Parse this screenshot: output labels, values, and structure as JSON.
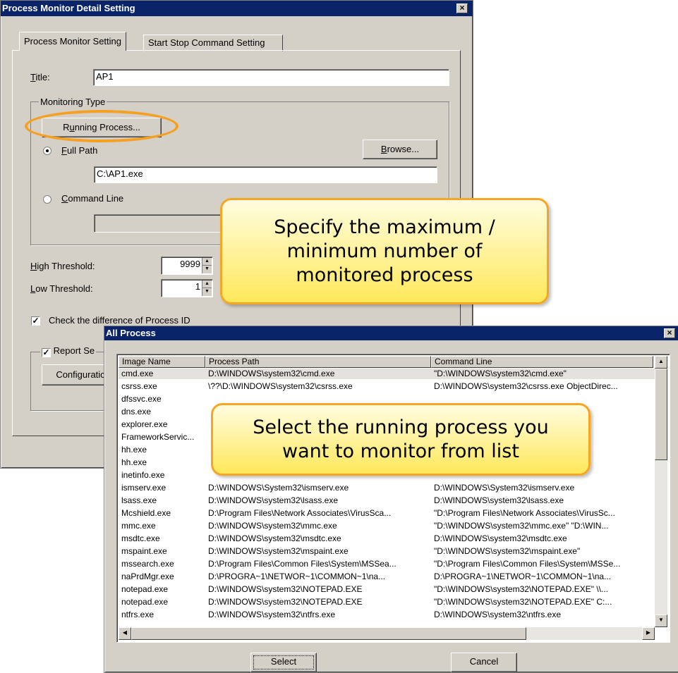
{
  "dialog1": {
    "title": "Process Monitor Detail Setting",
    "close_glyph": "×",
    "tabs": [
      "Process Monitor Setting",
      "Start Stop Command Setting"
    ],
    "title_label": "Title:",
    "title_value": "AP1",
    "monitoring_type_legend": "Monitoring Type",
    "running_process_button": "Running Process...",
    "full_path_label": "Full Path",
    "browse_button": "Browse...",
    "full_path_value": "C:\\AP1.exe",
    "command_line_label": "Command Line",
    "command_line_value": "",
    "high_threshold_label": "High Threshold:",
    "high_threshold_value": "9999",
    "low_threshold_label": "Low Threshold:",
    "low_threshold_value": "1",
    "check_pid_label": "Check the difference of Process ID",
    "check_pid_checked": true,
    "report_label": "Report Se",
    "report_checked": true,
    "configuration_button": "Configuratic"
  },
  "dialog2": {
    "title": "All Process",
    "close_glyph": "×",
    "columns": [
      "Image Name",
      "Process Path",
      "Command Line"
    ],
    "rows": [
      [
        "cmd.exe",
        "D:\\WINDOWS\\system32\\cmd.exe",
        "\"D:\\WINDOWS\\system32\\cmd.exe\""
      ],
      [
        "csrss.exe",
        "\\??\\D:\\WINDOWS\\system32\\csrss.exe",
        "D:\\WINDOWS\\system32\\csrss.exe ObjectDirec..."
      ],
      [
        "dfssvc.exe",
        "",
        ""
      ],
      [
        "dns.exe",
        "",
        ""
      ],
      [
        "explorer.exe",
        "",
        ""
      ],
      [
        "FrameworkServic...",
        "",
        "s\\Common..."
      ],
      [
        "hh.exe",
        "",
        "ents and S..."
      ],
      [
        "hh.exe",
        "",
        "ents and S..."
      ],
      [
        "inetinfo.exe",
        "",
        ""
      ],
      [
        "ismserv.exe",
        "D:\\WINDOWS\\System32\\ismserv.exe",
        "D:\\WINDOWS\\System32\\ismserv.exe"
      ],
      [
        "lsass.exe",
        "D:\\WINDOWS\\system32\\lsass.exe",
        "D:\\WINDOWS\\system32\\lsass.exe"
      ],
      [
        "Mcshield.exe",
        "D:\\Program Files\\Network Associates\\VirusSca...",
        "\"D:\\Program Files\\Network Associates\\VirusSc..."
      ],
      [
        "mmc.exe",
        "D:\\WINDOWS\\system32\\mmc.exe",
        "\"D:\\WINDOWS\\system32\\mmc.exe\" \"D:\\WIN..."
      ],
      [
        "msdtc.exe",
        "D:\\WINDOWS\\system32\\msdtc.exe",
        "D:\\WINDOWS\\system32\\msdtc.exe"
      ],
      [
        "mspaint.exe",
        "D:\\WINDOWS\\system32\\mspaint.exe",
        "\"D:\\WINDOWS\\system32\\mspaint.exe\""
      ],
      [
        "mssearch.exe",
        "D:\\Program Files\\Common Files\\System\\MSSea...",
        "\"D:\\Program Files\\Common Files\\System\\MSSe..."
      ],
      [
        "naPrdMgr.exe",
        "D:\\PROGRA~1\\NETWOR~1\\COMMON~1\\na...",
        "D:\\PROGRA~1\\NETWOR~1\\COMMON~1\\na..."
      ],
      [
        "notepad.exe",
        "D:\\WINDOWS\\system32\\NOTEPAD.EXE",
        "\"D:\\WINDOWS\\system32\\NOTEPAD.EXE\" \\\\..."
      ],
      [
        "notepad.exe",
        "D:\\WINDOWS\\system32\\NOTEPAD.EXE",
        "\"D:\\WINDOWS\\system32\\NOTEPAD.EXE\" C:..."
      ],
      [
        "ntfrs.exe",
        "D:\\WINDOWS\\system32\\ntfrs.exe",
        "D:\\WINDOWS\\system32\\ntfrs.exe"
      ]
    ],
    "select_button": "Select",
    "cancel_button": "Cancel"
  },
  "callouts": {
    "threshold": "Specify the maximum / minimum number of monitored process",
    "select": "Select the running process you want to monitor from list"
  },
  "colors": {
    "titlebar": "#0a246a",
    "callout_border": "#f5a623",
    "callout_fill": "#ffe85a"
  }
}
